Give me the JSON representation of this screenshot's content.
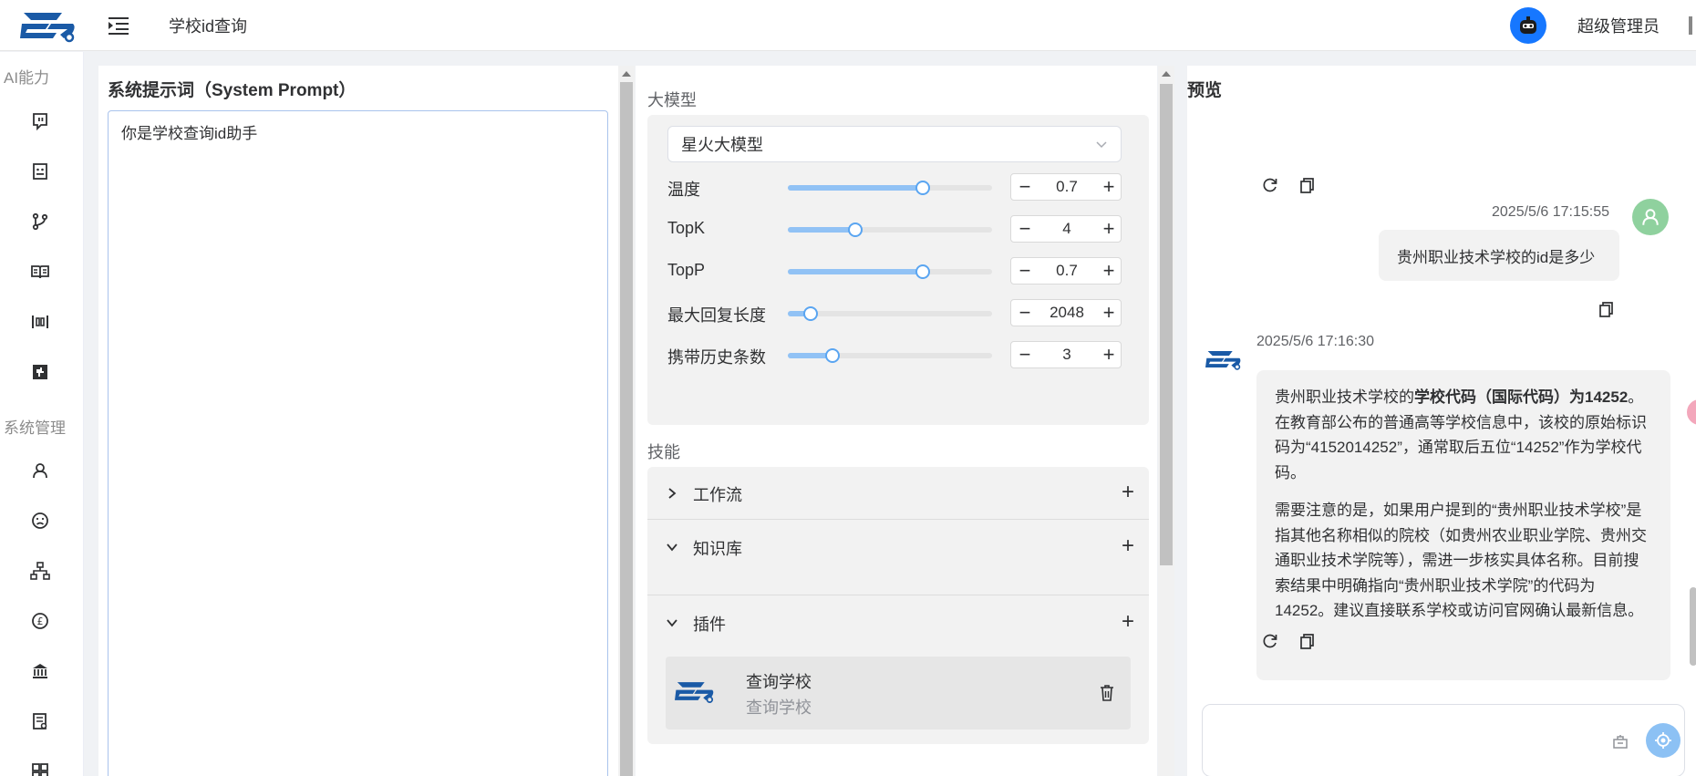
{
  "header": {
    "page_title": "学校id查询",
    "user_name": "超级管理员"
  },
  "sidebar": {
    "groups": [
      {
        "label": "AI能力",
        "items": [
          "bot-icon",
          "app-face-icon",
          "workflow-branch-icon",
          "book-icon",
          "model-tuning-icon",
          "plugin-puzzle-icon"
        ]
      },
      {
        "label": "系统管理",
        "items": [
          "user-icon",
          "role-face-icon",
          "org-tree-icon",
          "currency-icon",
          "bank-icon",
          "document-icon",
          "grid-icon"
        ]
      }
    ]
  },
  "prompt_panel": {
    "title": "系统提示词（System Prompt）",
    "prompt_text": "你是学校查询id助手"
  },
  "config_panel": {
    "model_label": "大模型",
    "model_selected": "星火大模型",
    "params": [
      {
        "label": "温度",
        "value": "0.7",
        "fraction": 0.66
      },
      {
        "label": "TopK",
        "value": "4",
        "fraction": 0.33
      },
      {
        "label": "TopP",
        "value": "0.7",
        "fraction": 0.66
      },
      {
        "label": "最大回复长度",
        "value": "2048",
        "fraction": 0.11
      },
      {
        "label": "携带历史条数",
        "value": "3",
        "fraction": 0.22
      }
    ],
    "skills_label": "技能",
    "skills": [
      {
        "name": "工作流",
        "expanded": false
      },
      {
        "name": "知识库",
        "expanded": true
      },
      {
        "name": "插件",
        "expanded": true
      }
    ],
    "plugin": {
      "name": "查询学校",
      "description": "查询学校"
    }
  },
  "preview_panel": {
    "title": "预览",
    "user_message": {
      "time": "2025/5/6 17:15:55",
      "text": "贵州职业技术学校的id是多少"
    },
    "bot_message": {
      "time": "2025/5/6 17:16:30",
      "p1_before": "贵州职业技术学校的",
      "p1_bold": "学校代码（国际代码）为14252",
      "p1_after": "。在教育部公布的普通高等学校信息中，该校的原始标识码为“4152014252”，通常取后五位“14252”作为学校代码。",
      "p2": "需要注意的是，如果用户提到的“贵州职业技术学校”是指其他名称相似的院校（如贵州农业职业学院、贵州交通职业技术学院等），需进一步核实具体名称。目前搜索结果中明确指向“贵州职业技术学院”的代码为14252。建议直接联系学校或访问官网确认最新信息。"
    },
    "input_placeholder": ""
  }
}
